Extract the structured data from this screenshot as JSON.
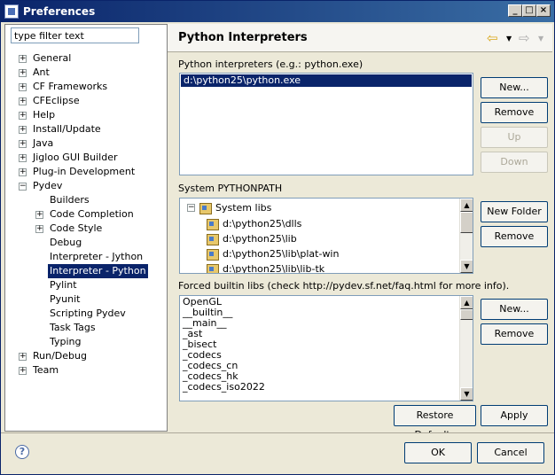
{
  "window": {
    "title": "Preferences"
  },
  "filter": {
    "value": "type filter text"
  },
  "tree": {
    "items": [
      {
        "label": "General",
        "expander": "+"
      },
      {
        "label": "Ant",
        "expander": "+"
      },
      {
        "label": "CF Frameworks",
        "expander": "+"
      },
      {
        "label": "CFEclipse",
        "expander": "+"
      },
      {
        "label": "Help",
        "expander": "+"
      },
      {
        "label": "Install/Update",
        "expander": "+"
      },
      {
        "label": "Java",
        "expander": "+"
      },
      {
        "label": "Jigloo GUI Builder",
        "expander": "+"
      },
      {
        "label": "Plug-in Development",
        "expander": "+"
      },
      {
        "label": "Pydev",
        "expander": "−"
      }
    ],
    "pydev_children": [
      {
        "label": "Builders",
        "expander": ""
      },
      {
        "label": "Code Completion",
        "expander": "+"
      },
      {
        "label": "Code Style",
        "expander": "+"
      },
      {
        "label": "Debug",
        "expander": ""
      },
      {
        "label": "Interpreter - Jython",
        "expander": ""
      },
      {
        "label": "Interpreter - Python",
        "expander": "",
        "selected": true
      },
      {
        "label": "Pylint",
        "expander": ""
      },
      {
        "label": "Pyunit",
        "expander": ""
      },
      {
        "label": "Scripting Pydev",
        "expander": ""
      },
      {
        "label": "Task Tags",
        "expander": ""
      },
      {
        "label": "Typing",
        "expander": ""
      }
    ],
    "after": [
      {
        "label": "Run/Debug",
        "expander": "+"
      },
      {
        "label": "Team",
        "expander": "+"
      }
    ]
  },
  "panel": {
    "title": "Python Interpreters",
    "interpreters_label": "Python interpreters (e.g.: python.exe)",
    "interpreters": [
      "d:\\python25\\python.exe"
    ],
    "buttons1": {
      "new": "New...",
      "remove": "Remove",
      "up": "Up",
      "down": "Down"
    },
    "pythonpath_label": "System PYTHONPATH",
    "system_libs_label": "System libs",
    "pythonpath": [
      "d:\\python25\\dlls",
      "d:\\python25\\lib",
      "d:\\python25\\lib\\plat-win",
      "d:\\python25\\lib\\lib-tk"
    ],
    "buttons2": {
      "new_folder": "New Folder",
      "remove": "Remove"
    },
    "forced_label": "Forced builtin libs (check http://pydev.sf.net/faq.html for more info).",
    "forced": [
      "OpenGL",
      "__builtin__",
      "__main__",
      "_ast",
      "_bisect",
      "_codecs",
      "_codecs_cn",
      "_codecs_hk",
      "_codecs_iso2022"
    ],
    "buttons3": {
      "new": "New...",
      "remove": "Remove"
    },
    "restore": "Restore Defaults",
    "apply": "Apply"
  },
  "footer": {
    "ok": "OK",
    "cancel": "Cancel",
    "help": "?"
  },
  "icons": {
    "back": "back-arrow-icon",
    "forward": "forward-arrow-icon",
    "python": "python-lib-icon"
  },
  "colors": {
    "selection": "#0a246a",
    "title_gradient_start": "#0a246a",
    "title_gradient_end": "#3a6ea5"
  }
}
